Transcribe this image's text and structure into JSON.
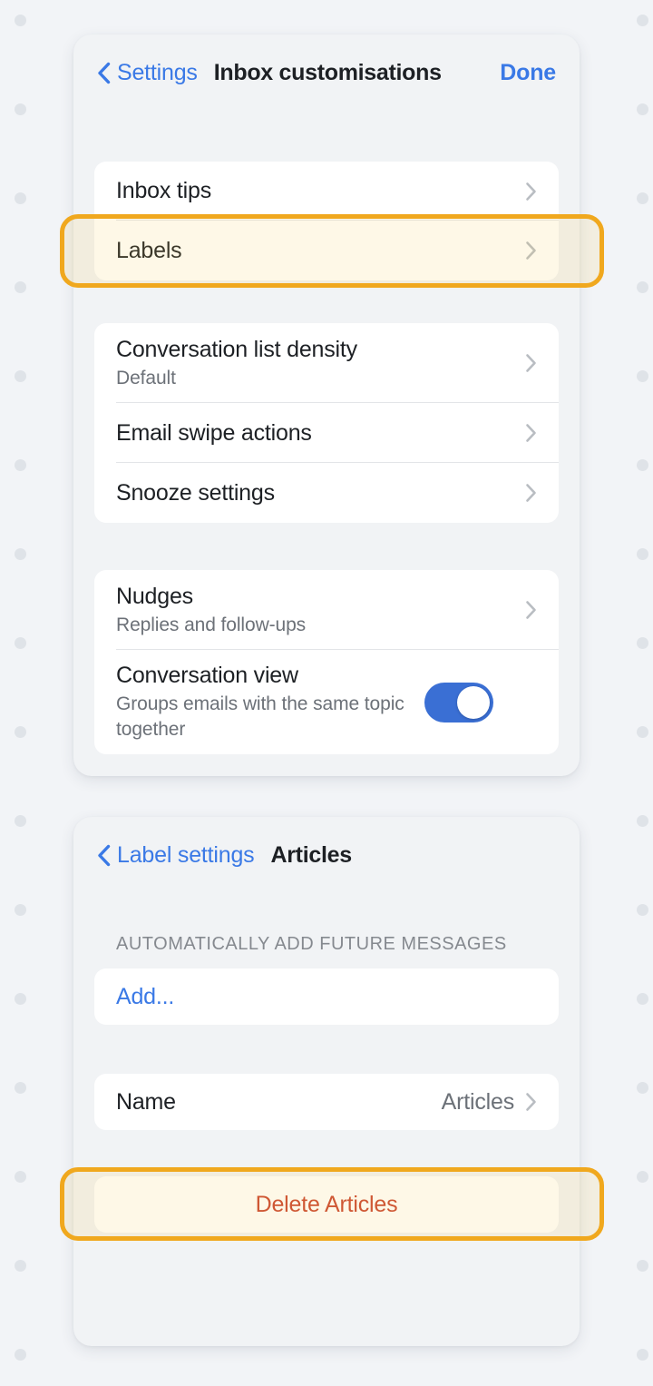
{
  "screen_inbox_customisations": {
    "nav": {
      "back_label": "Settings",
      "back_icon": "chevron-left-icon",
      "title": "Inbox customisations",
      "done_label": "Done"
    },
    "group_1": {
      "rows": [
        {
          "title": "Inbox tips",
          "accessory": "chevron-right-icon"
        },
        {
          "title": "Labels",
          "accessory": "chevron-right-icon"
        }
      ]
    },
    "group_2": {
      "rows": [
        {
          "title": "Conversation list density",
          "subtitle": "Default",
          "accessory": "chevron-right-icon"
        },
        {
          "title": "Email swipe actions",
          "accessory": "chevron-right-icon"
        },
        {
          "title": "Snooze settings",
          "accessory": "chevron-right-icon"
        }
      ]
    },
    "group_3": {
      "rows": [
        {
          "title": "Nudges",
          "subtitle": "Replies and follow-ups",
          "accessory": "chevron-right-icon"
        },
        {
          "title": "Conversation view",
          "subtitle": "Groups emails with the same topic together",
          "accessory": "toggle-switch",
          "toggle_on": true
        }
      ]
    }
  },
  "screen_label_articles": {
    "nav": {
      "back_label": "Label settings",
      "back_icon": "chevron-left-icon",
      "title": "Articles"
    },
    "section_caption": "AUTOMATICALLY ADD FUTURE MESSAGES",
    "add_row": {
      "label": "Add..."
    },
    "name_row": {
      "title": "Name",
      "value": "Articles",
      "accessory": "chevron-right-icon"
    },
    "delete_row": {
      "label": "Delete Articles"
    }
  },
  "annotations": {
    "highlight_color": "#f0a81e",
    "targets": [
      "Labels",
      "Delete Articles"
    ]
  },
  "colors": {
    "link_blue": "#3a79e6",
    "toggle_blue": "#3a6fd4",
    "destructive_red": "#c9452f",
    "page_background": "#f2f4f7",
    "panel_background": "#f1f3f5",
    "card_background": "#ffffff",
    "primary_text": "#1d2024",
    "secondary_text": "#6c7178"
  }
}
